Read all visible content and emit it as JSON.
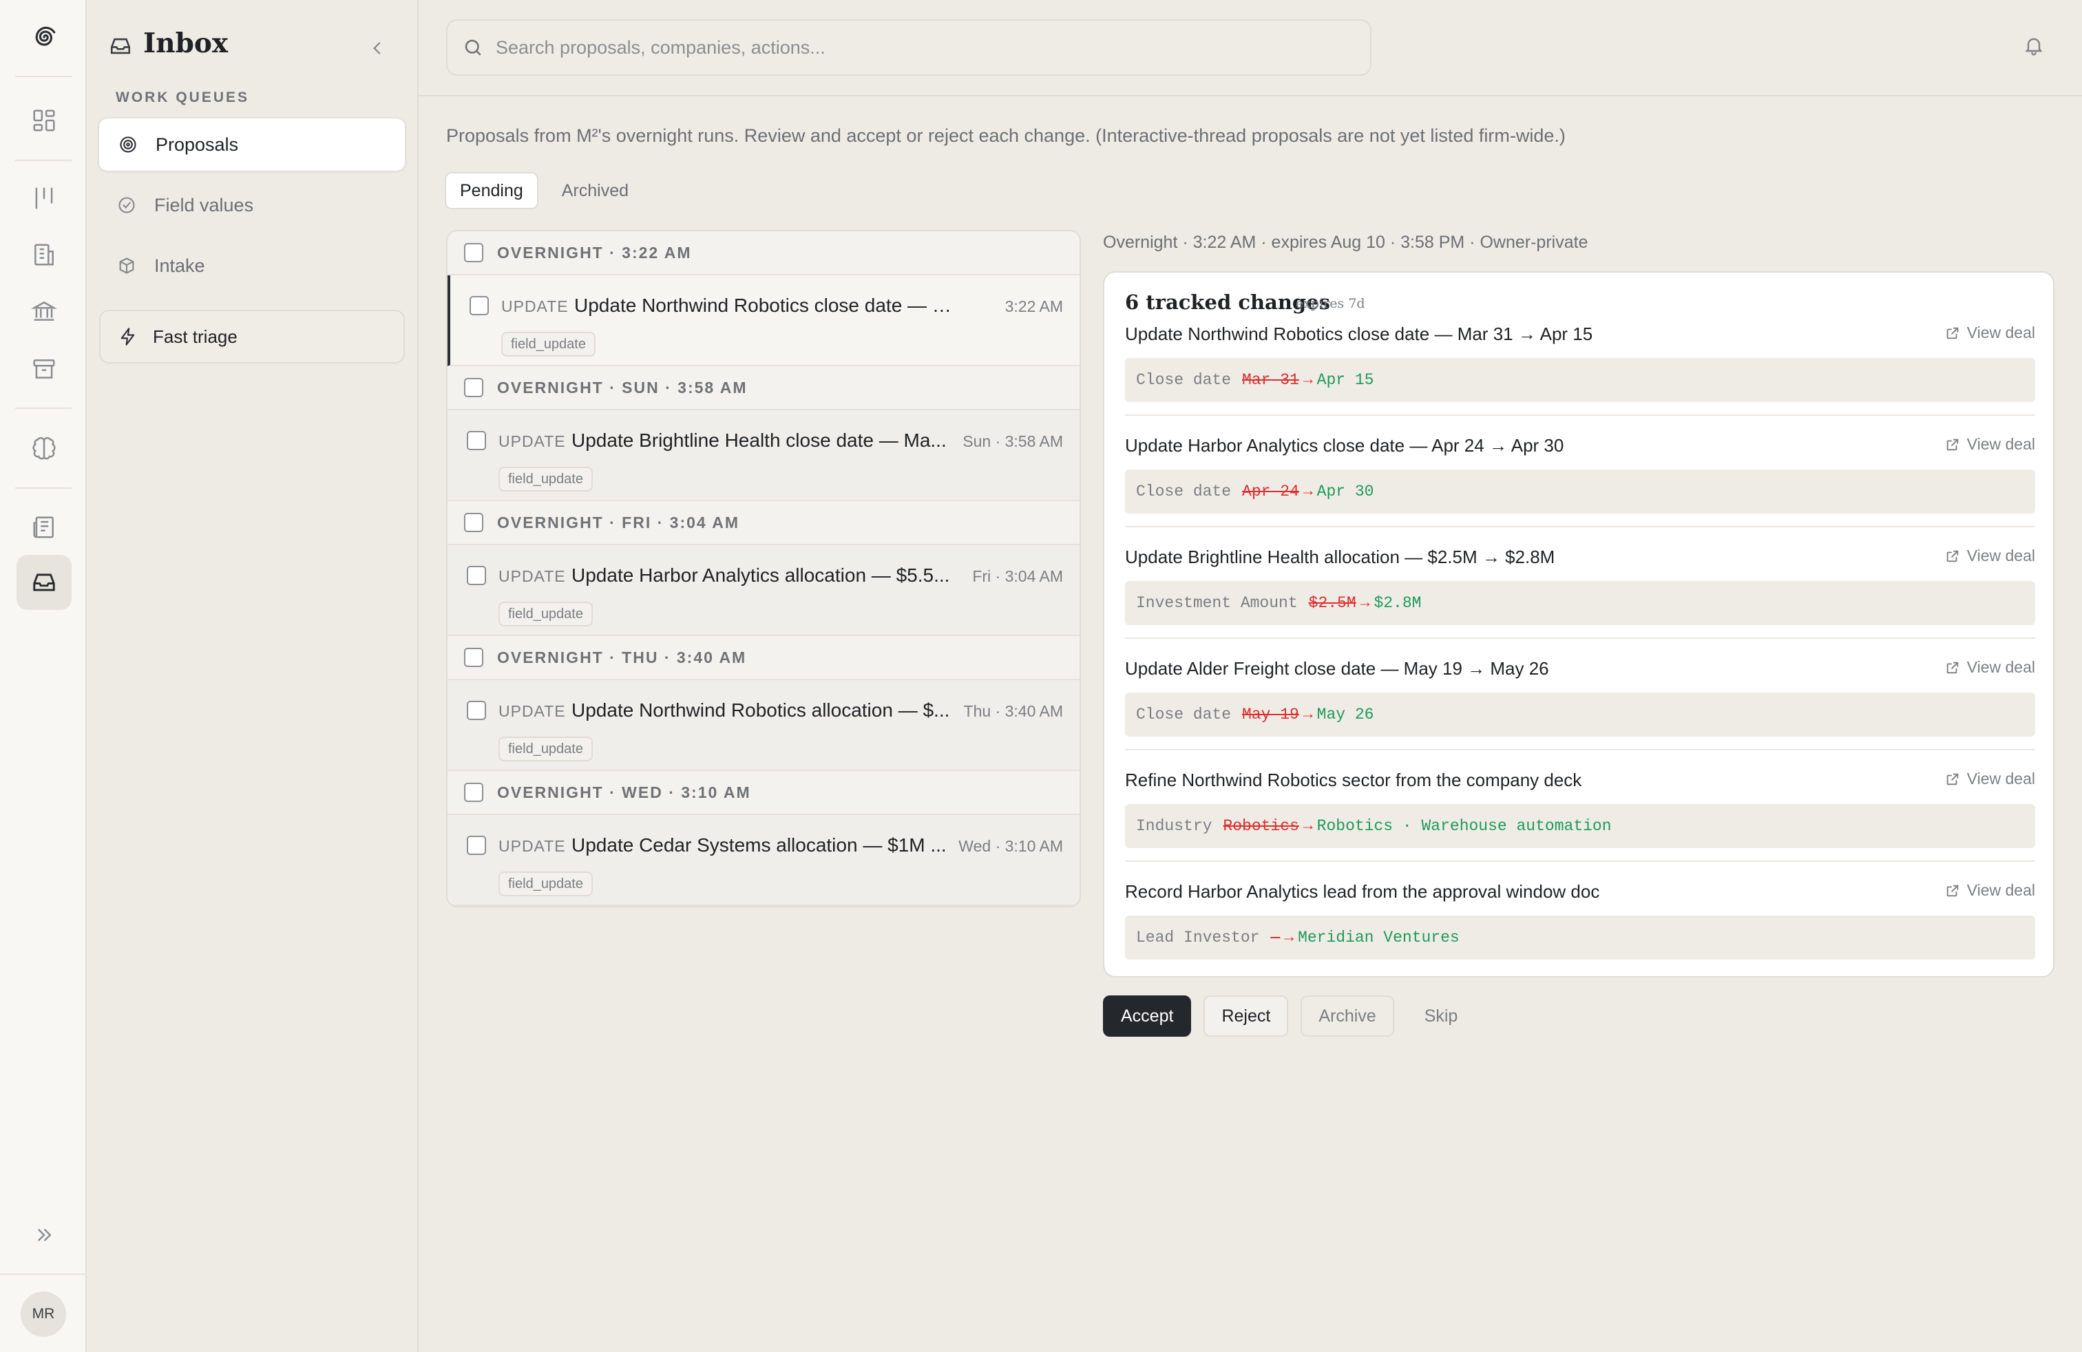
{
  "sidebar": {
    "title": "Inbox",
    "section_label": "WORK QUEUES",
    "queues": [
      {
        "label": "Proposals",
        "icon": "radar-icon",
        "active": true
      },
      {
        "label": "Field values",
        "icon": "check-circle-icon",
        "active": false
      },
      {
        "label": "Intake",
        "icon": "box-icon",
        "active": false
      }
    ],
    "fast_triage_label": "Fast triage"
  },
  "rail": {
    "avatar_initials": "MR"
  },
  "search": {
    "placeholder": "Search proposals, companies, actions..."
  },
  "main": {
    "intro": "Proposals from M²'s overnight runs. Review and accept or reject each change. (Interactive-thread proposals are not yet listed firm-wide.)",
    "tabs": [
      {
        "label": "Pending",
        "active": true
      },
      {
        "label": "Archived",
        "active": false
      }
    ]
  },
  "proposal_groups": [
    {
      "header": "OVERNIGHT · 3:22 AM",
      "kind": "UPDATE",
      "title": "Update Northwind Robotics close date — Mar ...",
      "time": "3:22 AM",
      "tag": "field_update",
      "selected": true
    },
    {
      "header": "OVERNIGHT · SUN · 3:58 AM",
      "kind": "UPDATE",
      "title": "Update Brightline Health close date — Ma...",
      "time": "Sun · 3:58 AM",
      "tag": "field_update",
      "selected": false
    },
    {
      "header": "OVERNIGHT · FRI · 3:04 AM",
      "kind": "UPDATE",
      "title": "Update Harbor Analytics allocation — $5.5...",
      "time": "Fri · 3:04 AM",
      "tag": "field_update",
      "selected": false
    },
    {
      "header": "OVERNIGHT · THU · 3:40 AM",
      "kind": "UPDATE",
      "title": "Update Northwind Robotics allocation — $...",
      "time": "Thu · 3:40 AM",
      "tag": "field_update",
      "selected": false
    },
    {
      "header": "OVERNIGHT · WED · 3:10 AM",
      "kind": "UPDATE",
      "title": "Update Cedar Systems allocation — $1M ...",
      "time": "Wed · 3:10 AM",
      "tag": "field_update",
      "selected": false
    }
  ],
  "detail": {
    "meta": "Overnight · 3:22 AM · expires Aug 10 · 3:58 PM · Owner-private",
    "card_title": "6 tracked changes",
    "card_expires": "expires 7d",
    "view_label": "View deal",
    "changes": [
      {
        "title": "Update Northwind Robotics close date — Mar 31 → Apr 15",
        "field": "Close date",
        "old": "Mar 31",
        "new": "Apr 15"
      },
      {
        "title": "Update Harbor Analytics close date — Apr 24 → Apr 30",
        "field": "Close date",
        "old": "Apr 24",
        "new": "Apr 30"
      },
      {
        "title": "Update Brightline Health allocation — $2.5M → $2.8M",
        "field": "Investment Amount",
        "old": "$2.5M",
        "new": "$2.8M"
      },
      {
        "title": "Update Alder Freight close date — May 19 → May 26",
        "field": "Close date",
        "old": "May 19",
        "new": "May 26"
      },
      {
        "title": "Refine Northwind Robotics sector from the company deck",
        "field": "Industry",
        "old": "Robotics",
        "new": "Robotics · Warehouse automation"
      },
      {
        "title": "Record Harbor Analytics lead from the approval window doc",
        "field": "Lead Investor",
        "old": "—",
        "new": "Meridian Ventures"
      }
    ],
    "arrow": "→"
  },
  "actions": {
    "accept": "Accept",
    "reject": "Reject",
    "archive": "Archive",
    "skip": "Skip"
  },
  "colors": {
    "accent_dark": "#24272b",
    "diff_removed": "#dc2f2f",
    "diff_added": "#1f9a5a",
    "background": "#eeebe5"
  }
}
